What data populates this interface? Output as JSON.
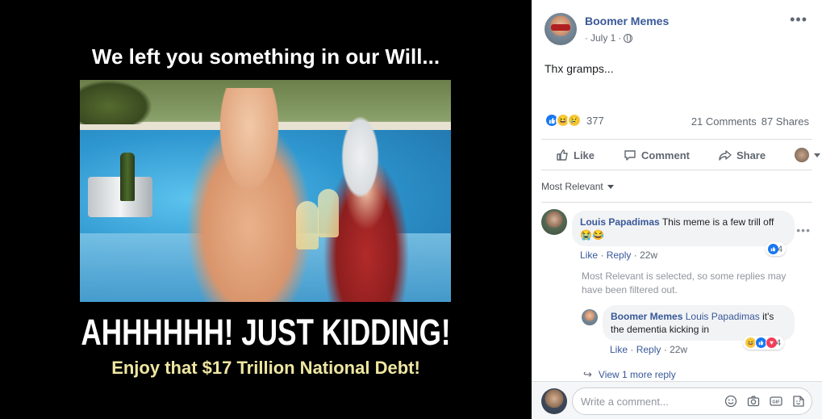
{
  "meme": {
    "top_text": "We left you something in our Will...",
    "mid_text": "AHHHHHH! JUST KIDDING!",
    "bottom_text": "Enjoy that $17 Trillion National Debt!"
  },
  "post": {
    "page_name": "Boomer Memes",
    "date": "July 1",
    "separator": "·",
    "text": "Thx gramps...",
    "more_icon": "more-horizontal-icon"
  },
  "stats": {
    "reaction_count": "377",
    "comments": "21 Comments",
    "shares": "87 Shares"
  },
  "actions": {
    "like": "Like",
    "comment": "Comment",
    "share": "Share"
  },
  "sort": {
    "label": "Most Relevant"
  },
  "comments": [
    {
      "author": "Louis Papadimas",
      "text": "This meme is a few trill off",
      "emoji": "😭😂",
      "reaction_count": "4",
      "like": "Like",
      "reply": "Reply",
      "time": "22w"
    }
  ],
  "filter_note": "Most Relevant is selected, so some replies may have been filtered out.",
  "reply": {
    "author": "Boomer Memes",
    "mention": "Louis Papadimas",
    "text": "it's the dementia kicking in",
    "reaction_count": "4",
    "like": "Like",
    "reply": "Reply",
    "time": "22w"
  },
  "view_more": "View 1 more reply",
  "composer": {
    "placeholder": "Write a comment..."
  },
  "colors": {
    "link_blue": "#385898",
    "like_blue": "#1877f2",
    "meme_yellow": "#efe6a1"
  }
}
